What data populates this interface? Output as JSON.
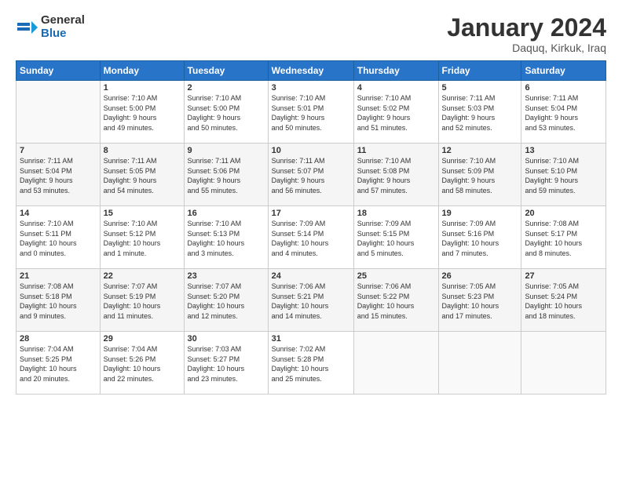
{
  "header": {
    "logo_general": "General",
    "logo_blue": "Blue",
    "month_title": "January 2024",
    "location": "Daquq, Kirkuk, Iraq"
  },
  "weekdays": [
    "Sunday",
    "Monday",
    "Tuesday",
    "Wednesday",
    "Thursday",
    "Friday",
    "Saturday"
  ],
  "weeks": [
    [
      {
        "day": "",
        "info": ""
      },
      {
        "day": "1",
        "info": "Sunrise: 7:10 AM\nSunset: 5:00 PM\nDaylight: 9 hours\nand 49 minutes."
      },
      {
        "day": "2",
        "info": "Sunrise: 7:10 AM\nSunset: 5:00 PM\nDaylight: 9 hours\nand 50 minutes."
      },
      {
        "day": "3",
        "info": "Sunrise: 7:10 AM\nSunset: 5:01 PM\nDaylight: 9 hours\nand 50 minutes."
      },
      {
        "day": "4",
        "info": "Sunrise: 7:10 AM\nSunset: 5:02 PM\nDaylight: 9 hours\nand 51 minutes."
      },
      {
        "day": "5",
        "info": "Sunrise: 7:11 AM\nSunset: 5:03 PM\nDaylight: 9 hours\nand 52 minutes."
      },
      {
        "day": "6",
        "info": "Sunrise: 7:11 AM\nSunset: 5:04 PM\nDaylight: 9 hours\nand 53 minutes."
      }
    ],
    [
      {
        "day": "7",
        "info": "Sunrise: 7:11 AM\nSunset: 5:04 PM\nDaylight: 9 hours\nand 53 minutes."
      },
      {
        "day": "8",
        "info": "Sunrise: 7:11 AM\nSunset: 5:05 PM\nDaylight: 9 hours\nand 54 minutes."
      },
      {
        "day": "9",
        "info": "Sunrise: 7:11 AM\nSunset: 5:06 PM\nDaylight: 9 hours\nand 55 minutes."
      },
      {
        "day": "10",
        "info": "Sunrise: 7:11 AM\nSunset: 5:07 PM\nDaylight: 9 hours\nand 56 minutes."
      },
      {
        "day": "11",
        "info": "Sunrise: 7:10 AM\nSunset: 5:08 PM\nDaylight: 9 hours\nand 57 minutes."
      },
      {
        "day": "12",
        "info": "Sunrise: 7:10 AM\nSunset: 5:09 PM\nDaylight: 9 hours\nand 58 minutes."
      },
      {
        "day": "13",
        "info": "Sunrise: 7:10 AM\nSunset: 5:10 PM\nDaylight: 9 hours\nand 59 minutes."
      }
    ],
    [
      {
        "day": "14",
        "info": "Sunrise: 7:10 AM\nSunset: 5:11 PM\nDaylight: 10 hours\nand 0 minutes."
      },
      {
        "day": "15",
        "info": "Sunrise: 7:10 AM\nSunset: 5:12 PM\nDaylight: 10 hours\nand 1 minute."
      },
      {
        "day": "16",
        "info": "Sunrise: 7:10 AM\nSunset: 5:13 PM\nDaylight: 10 hours\nand 3 minutes."
      },
      {
        "day": "17",
        "info": "Sunrise: 7:09 AM\nSunset: 5:14 PM\nDaylight: 10 hours\nand 4 minutes."
      },
      {
        "day": "18",
        "info": "Sunrise: 7:09 AM\nSunset: 5:15 PM\nDaylight: 10 hours\nand 5 minutes."
      },
      {
        "day": "19",
        "info": "Sunrise: 7:09 AM\nSunset: 5:16 PM\nDaylight: 10 hours\nand 7 minutes."
      },
      {
        "day": "20",
        "info": "Sunrise: 7:08 AM\nSunset: 5:17 PM\nDaylight: 10 hours\nand 8 minutes."
      }
    ],
    [
      {
        "day": "21",
        "info": "Sunrise: 7:08 AM\nSunset: 5:18 PM\nDaylight: 10 hours\nand 9 minutes."
      },
      {
        "day": "22",
        "info": "Sunrise: 7:07 AM\nSunset: 5:19 PM\nDaylight: 10 hours\nand 11 minutes."
      },
      {
        "day": "23",
        "info": "Sunrise: 7:07 AM\nSunset: 5:20 PM\nDaylight: 10 hours\nand 12 minutes."
      },
      {
        "day": "24",
        "info": "Sunrise: 7:06 AM\nSunset: 5:21 PM\nDaylight: 10 hours\nand 14 minutes."
      },
      {
        "day": "25",
        "info": "Sunrise: 7:06 AM\nSunset: 5:22 PM\nDaylight: 10 hours\nand 15 minutes."
      },
      {
        "day": "26",
        "info": "Sunrise: 7:05 AM\nSunset: 5:23 PM\nDaylight: 10 hours\nand 17 minutes."
      },
      {
        "day": "27",
        "info": "Sunrise: 7:05 AM\nSunset: 5:24 PM\nDaylight: 10 hours\nand 18 minutes."
      }
    ],
    [
      {
        "day": "28",
        "info": "Sunrise: 7:04 AM\nSunset: 5:25 PM\nDaylight: 10 hours\nand 20 minutes."
      },
      {
        "day": "29",
        "info": "Sunrise: 7:04 AM\nSunset: 5:26 PM\nDaylight: 10 hours\nand 22 minutes."
      },
      {
        "day": "30",
        "info": "Sunrise: 7:03 AM\nSunset: 5:27 PM\nDaylight: 10 hours\nand 23 minutes."
      },
      {
        "day": "31",
        "info": "Sunrise: 7:02 AM\nSunset: 5:28 PM\nDaylight: 10 hours\nand 25 minutes."
      },
      {
        "day": "",
        "info": ""
      },
      {
        "day": "",
        "info": ""
      },
      {
        "day": "",
        "info": ""
      }
    ]
  ]
}
